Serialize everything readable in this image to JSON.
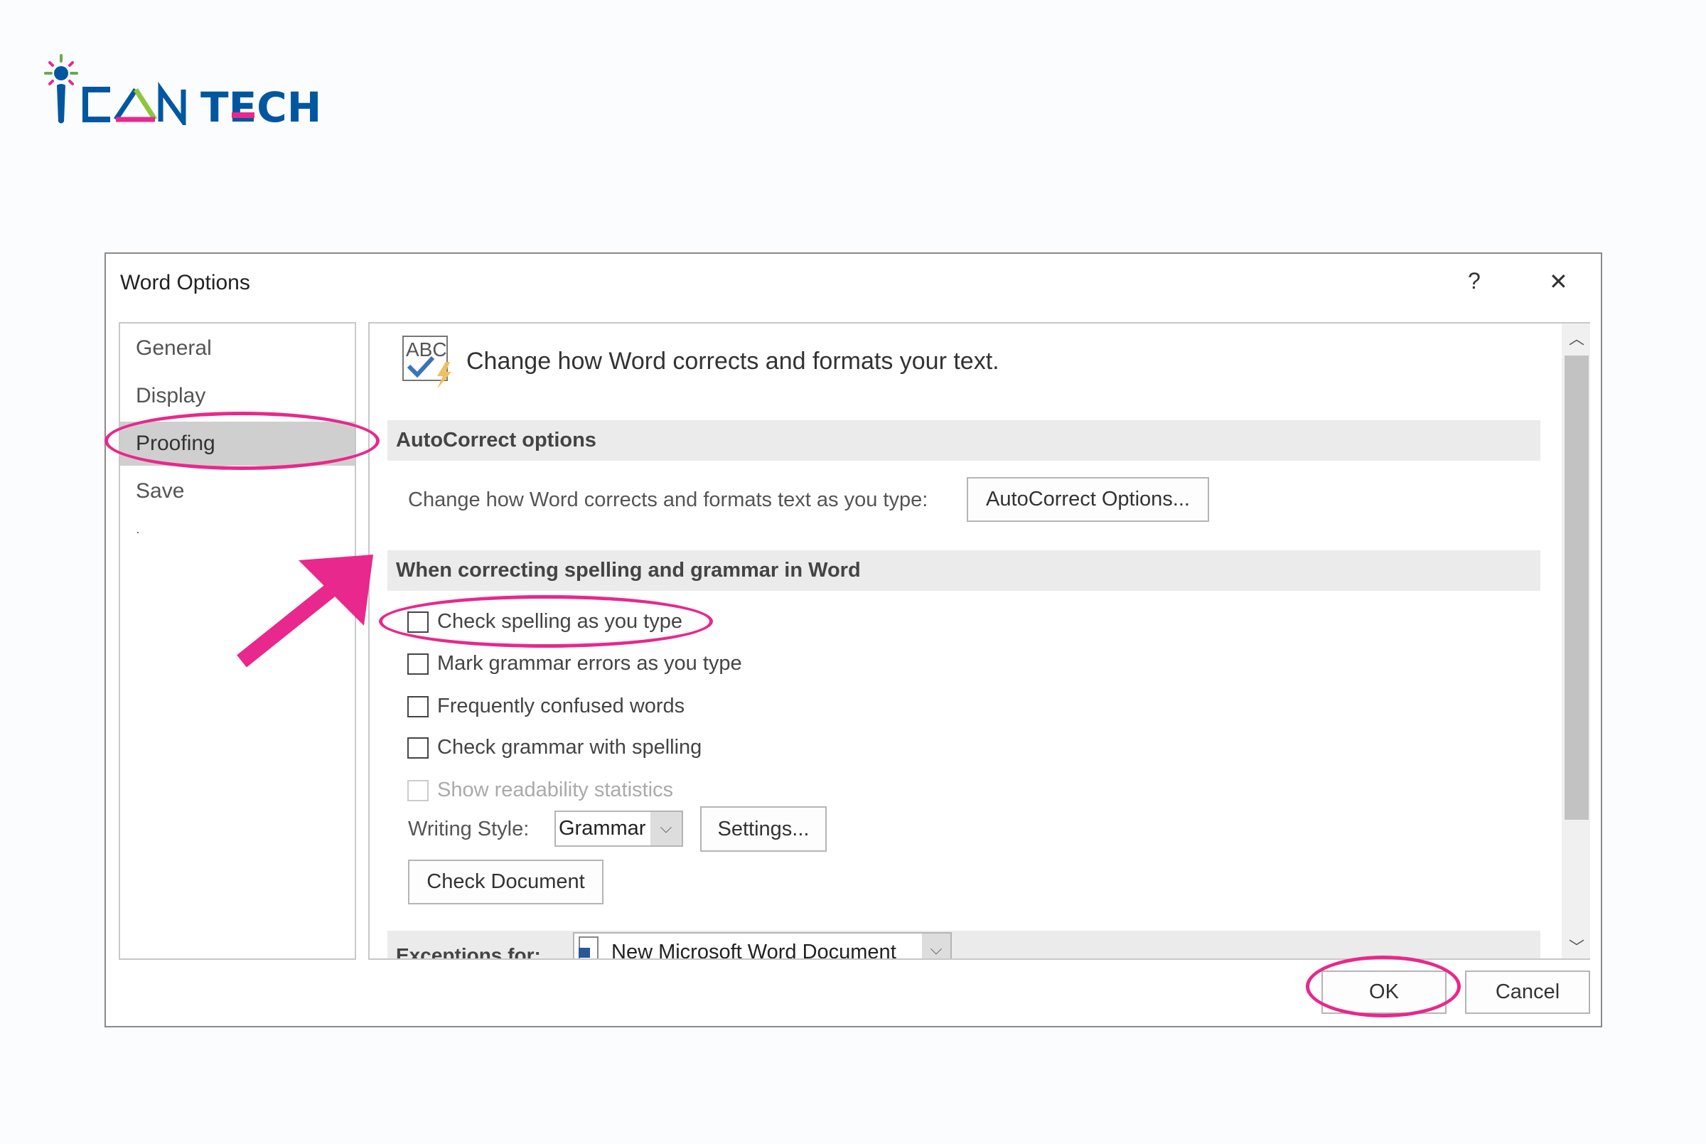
{
  "logo": {
    "text": "iCAN TECH"
  },
  "dialog": {
    "title": "Word Options",
    "help_label": "?",
    "close_label": "✕",
    "nav": [
      {
        "label": "General"
      },
      {
        "label": "Display"
      },
      {
        "label": "Proofing",
        "selected": true
      },
      {
        "label": "Save"
      },
      {
        "label": "·"
      }
    ],
    "heading": "Change how Word corrects and formats your text.",
    "autocorrect": {
      "section": "AutoCorrect options",
      "desc": "Change how Word corrects and formats text as you type:",
      "button": "AutoCorrect Options..."
    },
    "spelling": {
      "section": "When correcting spelling and grammar in Word",
      "options": [
        {
          "label": "Check spelling as you type",
          "checked": false,
          "enabled": true
        },
        {
          "label": "Mark grammar errors as you type",
          "checked": false,
          "enabled": true
        },
        {
          "label": "Frequently confused words",
          "checked": false,
          "enabled": true
        },
        {
          "label": "Check grammar with spelling",
          "checked": false,
          "enabled": true
        },
        {
          "label": "Show readability statistics",
          "checked": false,
          "enabled": false
        }
      ],
      "writing_style_label": "Writing Style:",
      "writing_style_value": "Grammar",
      "settings_button": "Settings...",
      "check_document_button": "Check Document"
    },
    "exceptions": {
      "label": "Exceptions for:",
      "document": "New Microsoft Word Document"
    },
    "ok": "OK",
    "cancel": "Cancel"
  },
  "colors": {
    "annotation": "#e8288c",
    "brand_blue": "#0057a0",
    "brand_green": "#8dc63f"
  }
}
